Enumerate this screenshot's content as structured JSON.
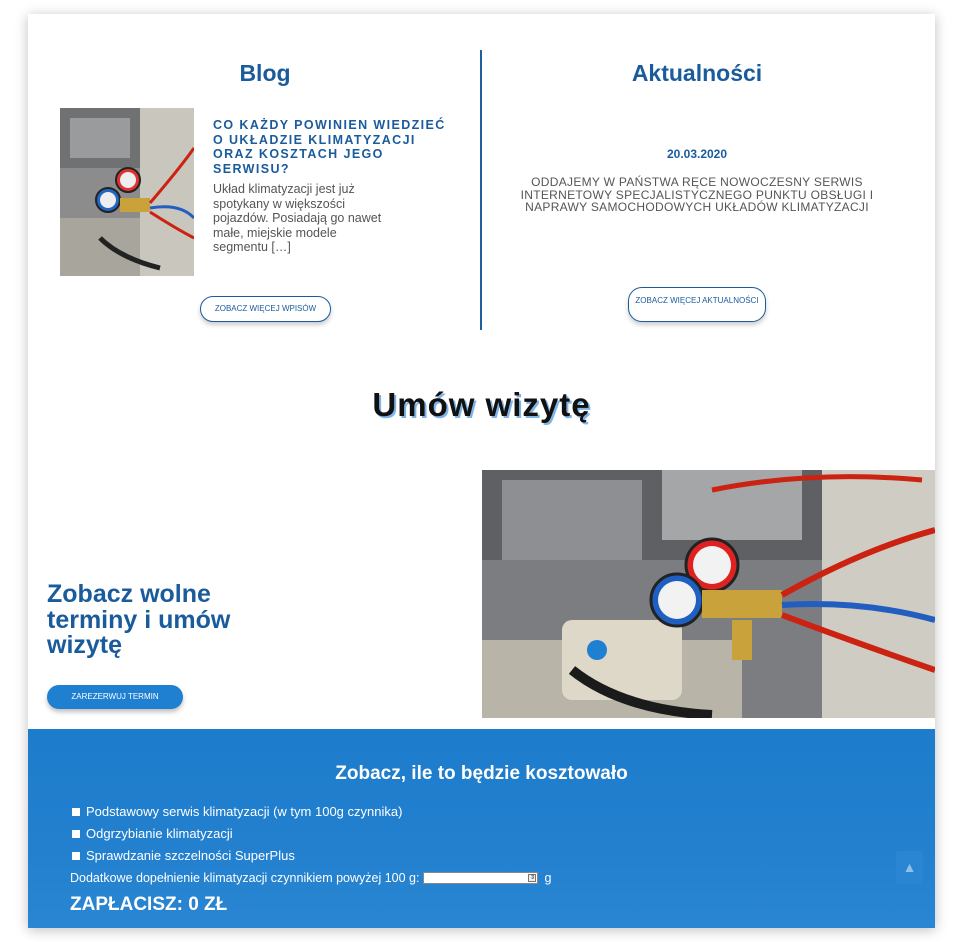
{
  "blog": {
    "title": "Blog",
    "post_heading": "Co każdy powinien wiedzieć o układzie klimatyzacji oraz kosztach jego serwisu?",
    "post_excerpt": "Układ klimatyzacji jest już spotykany w większości pojazdów. Posiadają go nawet małe, miejskie modele segmentu […]",
    "more_button": "Zobacz więcej wpisów"
  },
  "news": {
    "title": "Aktualności",
    "date": "20.03.2020",
    "text": "Oddajemy w Państwa ręce nowoczesny serwis internetowy specjalistycznego punktu obsługi i naprawy samochodowych układów klimatyzacji",
    "more_button": "Zobacz więcej aktualności"
  },
  "visit": {
    "title": "Umów wizytę",
    "heading": "Zobacz wolne terminy i umów wizytę",
    "reserve_button": "Zarezerwuj termin"
  },
  "pricing": {
    "title": "Zobacz, ile to będzie kosztowało",
    "options": [
      "Podstawowy serwis klimatyzacji (w tym 100g czynnika)",
      "Odgrzybianie klimatyzacji",
      "Sprawdzanie szczelności SuperPlus"
    ],
    "extra_label": "Dodatkowe dopełnienie klimatyzacji czynnikiem powyżej 100 g:",
    "extra_unit": "g",
    "total": "ZAPŁACISZ: 0 ZŁ"
  },
  "icons": {
    "scroll_top": "arrow-up-icon",
    "spinner": "spinner-icon"
  },
  "colors": {
    "brand_blue": "#1a5b9c",
    "accent_blue": "#1f7fd1"
  }
}
